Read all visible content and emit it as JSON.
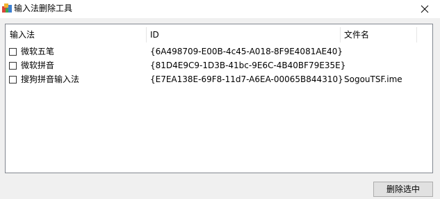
{
  "window": {
    "title": "输入法删除工具",
    "app_icon": "package-icon",
    "close_icon": "close-icon"
  },
  "list": {
    "columns": [
      "输入法",
      "ID",
      "文件名"
    ],
    "rows": [
      {
        "checked": false,
        "name": "微软五笔",
        "id": "{6A498709-E00B-4c45-A018-8F9E4081AE40}",
        "file": ""
      },
      {
        "checked": false,
        "name": "微软拼音",
        "id": "{81D4E9C9-1D3B-41bc-9E6C-4B40BF79E35E}",
        "file": ""
      },
      {
        "checked": false,
        "name": "搜狗拼音输入法",
        "id": "{E7EA138E-69F8-11d7-A6EA-00065B844310}",
        "file": "SogouTSF.ime"
      }
    ]
  },
  "actions": {
    "delete_label": "删除选中"
  }
}
